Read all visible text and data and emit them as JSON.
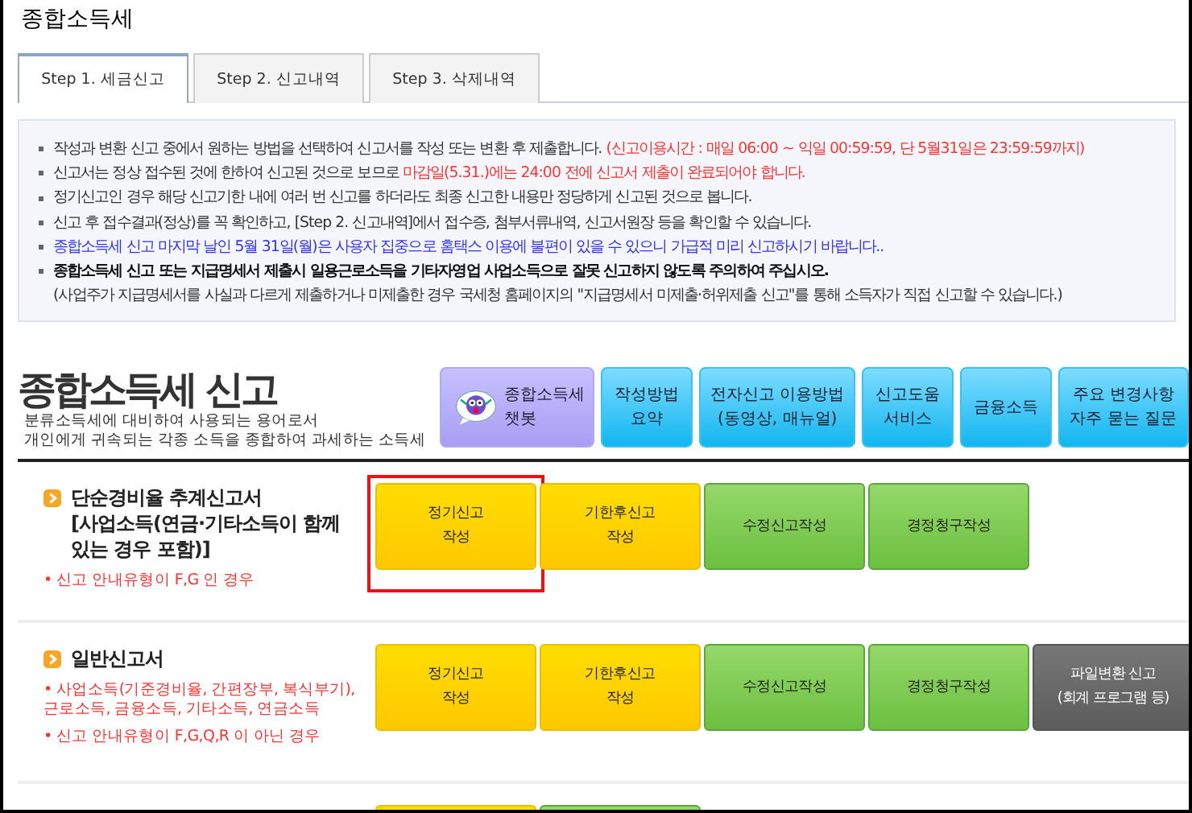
{
  "page_title": "종합소득세",
  "tabs": [
    {
      "label": "Step 1. 세금신고",
      "selected": true
    },
    {
      "label": "Step 2. 신고내역",
      "selected": false
    },
    {
      "label": "Step 3. 삭제내역",
      "selected": false
    }
  ],
  "notices": [
    {
      "bullet": true,
      "bold": false,
      "segments": [
        {
          "text": "작성과 변환 신고 중에서 원하는 방법을 선택하여 신고서를 작성 또는 변환 후 제출합니다. ",
          "color": "#333333"
        },
        {
          "text": "(신고이용시간 : 매일 06:00 ~ 익일 00:59:59, 단 5월31일은 23:59:59까지)",
          "color": "#ff3333"
        }
      ]
    },
    {
      "bullet": true,
      "bold": false,
      "segments": [
        {
          "text": "신고서는 정상 접수된 것에 한하여 신고된 것으로 보므로 ",
          "color": "#333333"
        },
        {
          "text": "마감일(5.31.)에는 24:00 전에 신고서 제출이 완료되어야 합니다.",
          "color": "#ff3333"
        }
      ]
    },
    {
      "bullet": true,
      "bold": false,
      "segments": [
        {
          "text": "정기신고인 경우 해당 신고기한 내에 여러 번 신고를 하더라도 최종 신고한 내용만 정당하게 신고된 것으로 봅니다.",
          "color": "#333333"
        }
      ]
    },
    {
      "bullet": true,
      "bold": false,
      "segments": [
        {
          "text": "신고 후 접수결과(정상)를 꼭 확인하고, [Step 2. 신고내역]에서 접수증, 첨부서류내역, 신고서원장 등을 확인할 수 있습니다.",
          "color": "#333333"
        }
      ]
    },
    {
      "bullet": true,
      "bold": false,
      "segments": [
        {
          "text": "종합소득세 신고 마지막 날인 5월 31일(월)은 사용자 집중으로 홈택스 이용에 불편이 있을 수 있으니 가급적 미리 신고하시기 바랍니다..",
          "color": "#3333ff"
        }
      ]
    },
    {
      "bullet": true,
      "bold": true,
      "segments": [
        {
          "text": "종합소득세 신고 또는 지급명세서 제출시 일용근로소득을 기타자영업 사업소득으로 잘못 신고하지 않도록 주의하여 주십시오.",
          "color": "#111111"
        }
      ]
    },
    {
      "bullet": false,
      "bold": false,
      "segments": [
        {
          "text": "(사업주가 지급명세서를 사실과 다르게 제출하거나 미제출한 경우 국세청 홈페이지의 \"지급명세서 미제출·허위제출 신고\"를 통해 소득자가 직접 신고할 수 있습니다.)",
          "color": "#333333"
        }
      ]
    }
  ],
  "heading": {
    "title": "종합소득세 신고",
    "description": [
      "분류소득세에 대비하여 사용되는 용어로서",
      "개인에게 귀속되는 각종 소득을 종합하여 과세하는 소득세"
    ]
  },
  "quick_links": [
    {
      "kind": "chatbot",
      "lines": [
        "종합소득세",
        "챗봇"
      ]
    },
    {
      "kind": "info",
      "lines": [
        "작성방법",
        "요약"
      ]
    },
    {
      "kind": "info",
      "lines": [
        "전자신고 이용방법",
        "(동영상, 매뉴얼)"
      ]
    },
    {
      "kind": "info",
      "lines": [
        "신고도움",
        "서비스"
      ]
    },
    {
      "kind": "info",
      "lines": [
        "금융소득"
      ]
    },
    {
      "kind": "info",
      "lines": [
        "주요 변경사항",
        "자주 묻는 질문"
      ]
    }
  ],
  "sections": [
    {
      "title_lines": [
        "단순경비율 추계신고서",
        "[사업소득(연금·기타소득이 함께",
        "있는 경우 포함)]"
      ],
      "notes": [
        "• 신고 안내유형이 F,G 인 경우"
      ],
      "buttons": [
        {
          "kind": "yellow",
          "lines": [
            "정기신고",
            "작성"
          ],
          "highlighted": true
        },
        {
          "kind": "yellow",
          "lines": [
            "기한후신고",
            "작성"
          ],
          "highlighted": false
        },
        {
          "kind": "green",
          "lines": [
            "수정신고작성"
          ],
          "highlighted": false
        },
        {
          "kind": "green",
          "lines": [
            "경정청구작성"
          ],
          "highlighted": false
        }
      ]
    },
    {
      "title_lines": [
        "일반신고서"
      ],
      "notes": [
        "• 사업소득(기준경비율, 간편장부, 복식부기),\n근로소득, 금융소득, 기타소득, 연금소득",
        "• 신고 안내유형이 F,G,Q,R 이 아닌 경우"
      ],
      "buttons": [
        {
          "kind": "yellow",
          "lines": [
            "정기신고",
            "작성"
          ],
          "highlighted": false
        },
        {
          "kind": "yellow",
          "lines": [
            "기한후신고",
            "작성"
          ],
          "highlighted": false
        },
        {
          "kind": "green",
          "lines": [
            "수정신고작성"
          ],
          "highlighted": false
        },
        {
          "kind": "green",
          "lines": [
            "경정청구작성"
          ],
          "highlighted": false
        },
        {
          "kind": "gray",
          "lines": [
            "파일변환 신고",
            "(회계 프로그램 등)"
          ],
          "highlighted": false
        }
      ]
    },
    {
      "buttons": [
        {
          "kind": "yellow",
          "highlighted": false
        },
        {
          "kind": "green",
          "highlighted": false
        }
      ]
    }
  ]
}
